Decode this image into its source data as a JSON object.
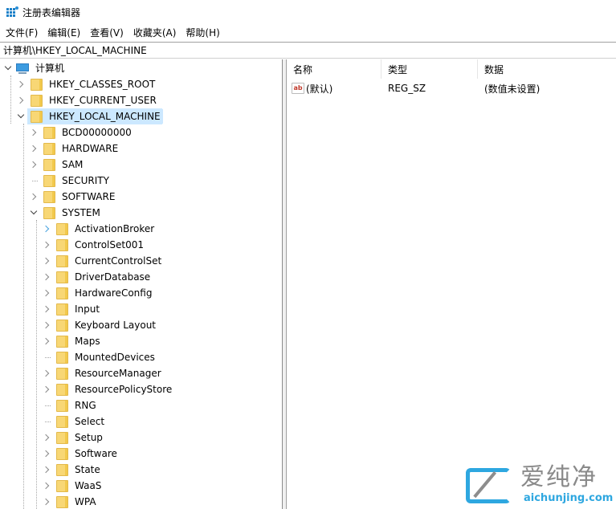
{
  "window": {
    "title": "注册表编辑器",
    "icon": "regedit-icon"
  },
  "menu": [
    {
      "label": "文件(F)"
    },
    {
      "label": "编辑(E)"
    },
    {
      "label": "查看(V)"
    },
    {
      "label": "收藏夹(A)"
    },
    {
      "label": "帮助(H)"
    }
  ],
  "address": {
    "path": "计算机\\HKEY_LOCAL_MACHINE"
  },
  "tree": {
    "root": {
      "label": "计算机",
      "icon": "computer-icon",
      "state": "expanded"
    },
    "hives": [
      {
        "label": "HKEY_CLASSES_ROOT",
        "state": "collapsed"
      },
      {
        "label": "HKEY_CURRENT_USER",
        "state": "collapsed"
      },
      {
        "label": "HKEY_LOCAL_MACHINE",
        "state": "expanded",
        "selected": true
      }
    ],
    "hklm_children": [
      {
        "label": "BCD00000000",
        "state": "collapsed"
      },
      {
        "label": "HARDWARE",
        "state": "collapsed"
      },
      {
        "label": "SAM",
        "state": "collapsed"
      },
      {
        "label": "SECURITY",
        "state": "leaf"
      },
      {
        "label": "SOFTWARE",
        "state": "collapsed"
      },
      {
        "label": "SYSTEM",
        "state": "expanded"
      }
    ],
    "system_children": [
      {
        "label": "ActivationBroker",
        "state": "collapsed-hover"
      },
      {
        "label": "ControlSet001",
        "state": "collapsed"
      },
      {
        "label": "CurrentControlSet",
        "state": "collapsed"
      },
      {
        "label": "DriverDatabase",
        "state": "collapsed"
      },
      {
        "label": "HardwareConfig",
        "state": "collapsed"
      },
      {
        "label": "Input",
        "state": "collapsed"
      },
      {
        "label": "Keyboard Layout",
        "state": "collapsed"
      },
      {
        "label": "Maps",
        "state": "collapsed"
      },
      {
        "label": "MountedDevices",
        "state": "leaf"
      },
      {
        "label": "ResourceManager",
        "state": "collapsed"
      },
      {
        "label": "ResourcePolicyStore",
        "state": "collapsed"
      },
      {
        "label": "RNG",
        "state": "leaf"
      },
      {
        "label": "Select",
        "state": "leaf"
      },
      {
        "label": "Setup",
        "state": "collapsed"
      },
      {
        "label": "Software",
        "state": "collapsed"
      },
      {
        "label": "State",
        "state": "collapsed"
      },
      {
        "label": "WaaS",
        "state": "collapsed"
      },
      {
        "label": "WPA",
        "state": "collapsed"
      }
    ]
  },
  "list": {
    "columns": [
      {
        "label": "名称"
      },
      {
        "label": "类型"
      },
      {
        "label": "数据"
      }
    ],
    "rows": [
      {
        "icon": "string-value-icon",
        "name": "(默认)",
        "type": "REG_SZ",
        "data": "(数值未设置)"
      }
    ]
  },
  "watermark": {
    "cn": "爱纯净",
    "en": "aichunjing.com",
    "color": "#2ea7e0"
  },
  "colors": {
    "selection": "#cce8ff",
    "folder": "#f8d775",
    "hover_chevron": "#4aa3df"
  }
}
